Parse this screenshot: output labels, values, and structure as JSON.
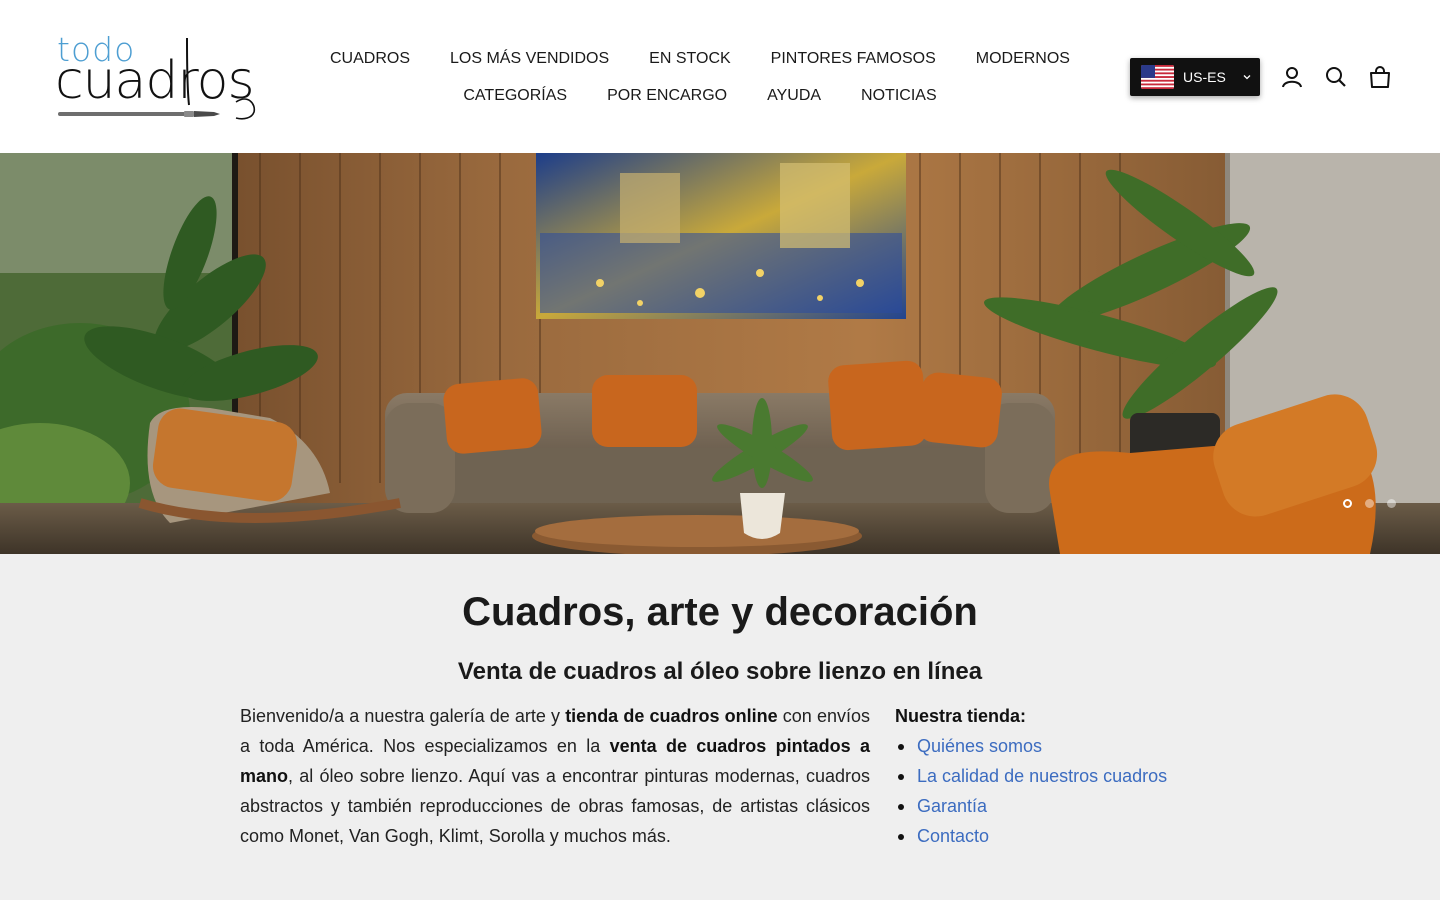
{
  "brand": {
    "logo_top": "todo",
    "logo_bottom": "cuadros",
    "colors": {
      "logo_accent": "#4d9ed2",
      "link": "#3c6cc0",
      "content_bg": "#efefef"
    }
  },
  "nav": {
    "row1": [
      "CUADROS",
      "LOS MÁS VENDIDOS",
      "EN STOCK",
      "PINTORES FAMOSOS",
      "MODERNOS"
    ],
    "row2": [
      "CATEGORÍAS",
      "POR ENCARGO",
      "AYUDA",
      "NOTICIAS"
    ]
  },
  "header": {
    "locale_label": "US-ES",
    "locale_flag": "us-flag-icon",
    "icons": [
      "account-icon",
      "search-icon",
      "cart-bag-icon"
    ]
  },
  "hero": {
    "slide_count": 3,
    "active_slide": 1
  },
  "content": {
    "title": "Cuadros, arte y decoración",
    "subtitle": "Venta de cuadros al óleo sobre lienzo en línea",
    "intro": {
      "p1": "Bienvenido/a a nuestra galería de arte y ",
      "b1": "tienda de cuadros online",
      "p2": " con envíos a toda América. Nos especializamos en la ",
      "b2": "venta de cuadros pintados a mano",
      "p3": ", al óleo sobre lienzo. Aquí vas a encontrar pinturas modernas, cuadros abstractos y también reproducciones de obras famosas, de artistas clásicos como Monet, Van Gogh, Klimt, Sorolla y muchos más."
    },
    "store_heading": "Nuestra tienda:",
    "store_links": [
      "Quiénes somos",
      "La calidad de nuestros cuadros",
      "Garantía",
      "Contacto"
    ]
  }
}
